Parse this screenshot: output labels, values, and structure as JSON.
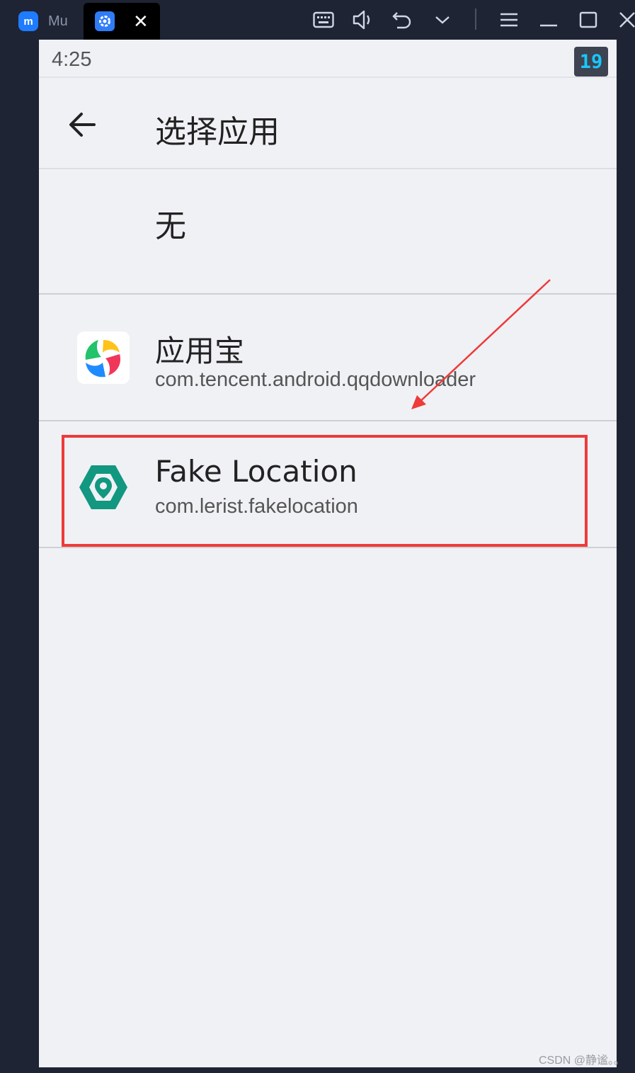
{
  "window": {
    "tabs": [
      {
        "label": "Mu",
        "active": false
      },
      {
        "label": "",
        "active": true
      }
    ],
    "close_glyph": "✕",
    "toolbar_icons": [
      "keyboard-icon",
      "volume-icon",
      "undo-icon",
      "chevron-down-icon",
      "menu-icon",
      "minimize-icon",
      "maximize-icon",
      "close-icon"
    ]
  },
  "status_bar": {
    "time": "4:25",
    "badge": "19"
  },
  "app_bar": {
    "title": "选择应用"
  },
  "list": {
    "none_label": "无",
    "apps": [
      {
        "name": "应用宝",
        "package": "com.tencent.android.qqdownloader",
        "icon": "yingyongbao-icon"
      },
      {
        "name": "Fake Location",
        "package": "com.lerist.fakelocation",
        "icon": "fake-location-icon"
      }
    ]
  },
  "annotation": {
    "highlight_color": "#ee3a3a",
    "arrow_color": "#ee3a3a"
  },
  "watermark": "CSDN @静谧。。"
}
